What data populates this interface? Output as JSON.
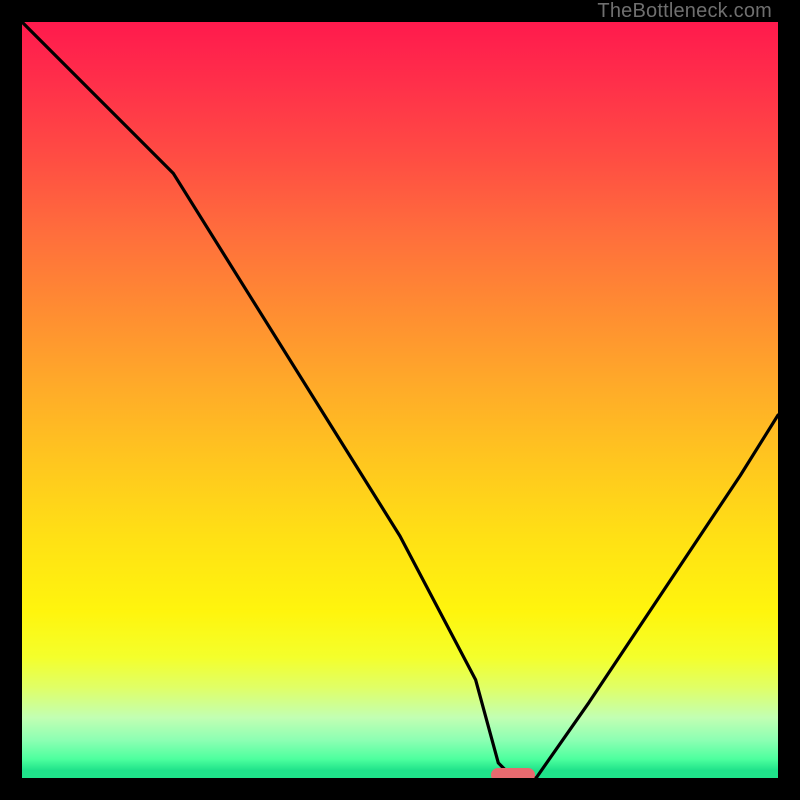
{
  "watermark": "TheBottleneck.com",
  "marker": {
    "x_pct": 65,
    "y_pct": 0
  },
  "chart_data": {
    "type": "line",
    "title": "",
    "xlabel": "",
    "ylabel": "",
    "xlim": [
      0,
      100
    ],
    "ylim": [
      0,
      100
    ],
    "series": [
      {
        "name": "bottleneck-curve",
        "x": [
          0,
          10,
          20,
          30,
          40,
          50,
          60,
          63,
          65,
          68,
          75,
          85,
          95,
          100
        ],
        "y": [
          100,
          90,
          80,
          64,
          48,
          32,
          13,
          2,
          0,
          0,
          10,
          25,
          40,
          48
        ]
      }
    ],
    "annotations": [
      {
        "type": "marker",
        "x": 65,
        "y": 0,
        "label": "optimal-point"
      }
    ]
  }
}
